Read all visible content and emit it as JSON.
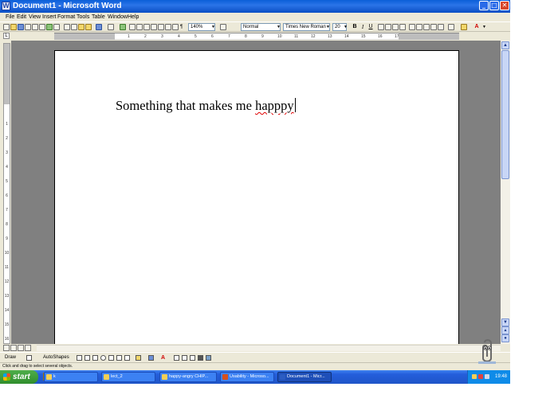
{
  "window": {
    "title": "Document1 - Microsoft Word",
    "minimize": "_",
    "maximize": "□",
    "close": "✕",
    "doc_close": "✕"
  },
  "menu": [
    "File",
    "Edit",
    "View",
    "Insert",
    "Format",
    "Tools",
    "Table",
    "Window",
    "Help"
  ],
  "toolbar": {
    "zoom": "140%",
    "style": "Normal",
    "font": "Times New Roman",
    "size": "20",
    "bold": "B",
    "italic": "I",
    "underline": "U",
    "pilcrow": "¶",
    "read": "Read"
  },
  "ruler": {
    "corner": "L",
    "numbers": [
      "1",
      "2",
      "3",
      "4",
      "5",
      "6",
      "7",
      "8",
      "9",
      "10",
      "11",
      "12",
      "13",
      "14",
      "15",
      "16",
      "17"
    ]
  },
  "vruler": {
    "numbers": [
      "1",
      "2",
      "3",
      "4",
      "5",
      "6",
      "7",
      "8",
      "9",
      "10",
      "11",
      "12",
      "13",
      "14",
      "15",
      "16"
    ]
  },
  "document": {
    "text": "Something that makes me ",
    "misspelled_word": "happpy"
  },
  "drawing_toolbar": {
    "draw": "Draw",
    "autoshapes": "AutoShapes"
  },
  "status": {
    "text": "Click and drag to select several objects."
  },
  "taskbar": {
    "start": "start",
    "buttons": [
      {
        "label": "k",
        "icon_color": "#f3cf57"
      },
      {
        "label": "lect_2",
        "icon_color": "#f3cf57"
      },
      {
        "label": "happy-angry CHIP...",
        "icon_color": "#f3cf57"
      },
      {
        "label": "Usability - Microso...",
        "icon_color": "#d6501e"
      },
      {
        "label": "Document1 - Micr...",
        "icon_color": "#2b5cc2"
      }
    ],
    "clock": "19:48"
  }
}
